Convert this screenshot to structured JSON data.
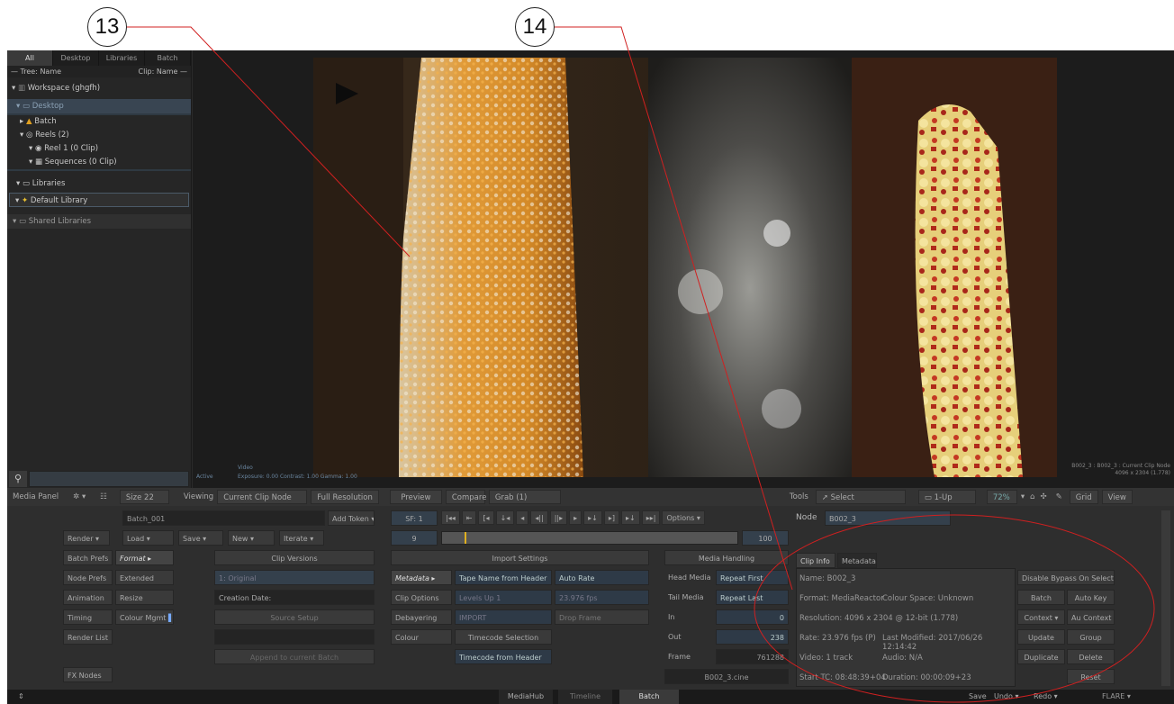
{
  "callouts": {
    "a": "13",
    "b": "14"
  },
  "left_panel": {
    "tabs": [
      "All",
      "Desktop",
      "Libraries",
      "Batch"
    ],
    "tree_header": "— Tree: Name",
    "clip_header": "Clip: Name —",
    "workspace": "Workspace (ghgfh)",
    "desktop": "Desktop",
    "batch": "Batch",
    "reels": "Reels (2)",
    "reel1": "Reel 1 (0 Clip)",
    "sequences": "Sequences (0 Clip)",
    "libraries": "Libraries",
    "default_library": "Default Library",
    "shared_libraries": "Shared Libraries",
    "media_panel": "Media Panel",
    "size": "Size 22"
  },
  "viewer": {
    "status_active": "Active",
    "status_video": "Video",
    "status_line": "Exposure: 0.00   Contrast: 1.00    Gamma: 1.00",
    "info_line1": "B002_3 : B002_3 : Current Clip Node",
    "info_line2": "4096 x 2304 (1.778)"
  },
  "toolbar": {
    "viewing_label": "Viewing",
    "viewing_value": "Current Clip Node",
    "full_res": "Full Resolution",
    "preview": "Preview",
    "compare": "Compare",
    "grab": "Grab (1)",
    "tools": "Tools",
    "select": "Select",
    "one_up": "1-Up",
    "zoom": "72%",
    "grid": "Grid",
    "view": "View"
  },
  "batch": {
    "name": "Batch_001",
    "add_token": "Add Token",
    "render": "Render",
    "load": "Load",
    "save": "Save",
    "new": "New",
    "iterate": "Iterate",
    "batch_prefs": "Batch Prefs",
    "format": "Format",
    "node_prefs": "Node Prefs",
    "extended": "Extended",
    "animation": "Animation",
    "resize": "Resize",
    "timing": "Timing",
    "colour_mgmt": "Colour Mgmt",
    "render_list": "Render List",
    "fx_nodes": "FX Nodes"
  },
  "clip_versions": {
    "title": "Clip Versions",
    "original": "1: Original",
    "creation": "Creation Date:",
    "source_setup": "Source Setup",
    "append": "Append to current Batch"
  },
  "transport": {
    "sf": "SF: 1",
    "start": "9",
    "end": "100",
    "options": "Options",
    "node_label": "Node",
    "node_value": "B002_3"
  },
  "import_settings": {
    "title": "Import Settings",
    "metadata": "Metadata",
    "tape_name": "Tape Name from Header",
    "auto_rate": "Auto Rate",
    "clip_options": "Clip Options",
    "levels": "Levels Up 1",
    "fps": "23.976 fps",
    "debayering": "Debayering",
    "import": "IMPORT",
    "drop_frame": "Drop Frame",
    "colour": "Colour",
    "timecode_selection": "Timecode Selection",
    "timecode_header": "Timecode from Header"
  },
  "media_handling": {
    "title": "Media Handling",
    "head_media": "Head Media",
    "repeat_first": "Repeat First",
    "tail_media": "Tail Media",
    "repeat_last": "Repeat Last",
    "in_label": "In",
    "in_value": "0",
    "out_label": "Out",
    "out_value": "238",
    "frame_label": "Frame",
    "frame_value": "761288",
    "file": "B002_3.cine"
  },
  "clip_info": {
    "tab_info": "Clip Info",
    "tab_meta": "Metadata",
    "name": "Name: B002_3",
    "format": "Format: MediaReactor",
    "colour_space": "Colour Space: Unknown",
    "resolution": "Resolution: 4096 x 2304 @ 12-bit (1.778)",
    "rate": "Rate: 23.976 fps (P)",
    "last_modified": "Last Modified: 2017/06/26 12:14:42",
    "video": "Video: 1 track",
    "audio": "Audio: N/A",
    "start_tc": "Start TC: 08:48:39+04",
    "duration": "Duration: 00:00:09+23"
  },
  "right_buttons": {
    "disable_bypass": "Disable Bypass On Selection",
    "batch": "Batch",
    "auto_key": "Auto Key",
    "context": "Context",
    "au_context": "Au Context",
    "update": "Update",
    "group": "Group",
    "duplicate": "Duplicate",
    "delete": "Delete",
    "reset": "Reset"
  },
  "status_bar": {
    "tab_mediahub": "MediaHub",
    "tab_timeline": "Timeline",
    "tab_batch": "Batch",
    "save": "Save",
    "undo": "Undo",
    "redo": "Redo",
    "app": "FLARE"
  }
}
